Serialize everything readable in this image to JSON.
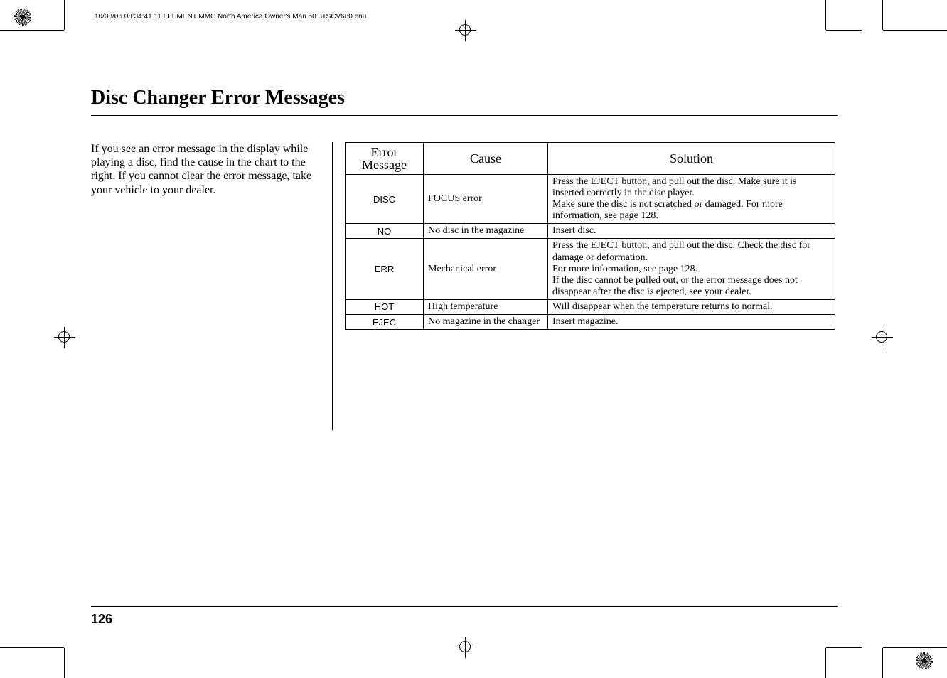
{
  "header": {
    "metadata": "10/08/06 08:34:41   11 ELEMENT MMC North America Owner's Man 50 31SCV680 enu"
  },
  "page_title": "Disc Changer Error Messages",
  "intro_text": "If you see an error message in the display while playing a disc, find the cause in the chart to the right. If you cannot clear the error message, take your vehicle to your dealer.",
  "table": {
    "headers": {
      "error": "Error Message",
      "cause": "Cause",
      "solution": "Solution"
    },
    "rows": [
      {
        "error": "DISC",
        "cause": "FOCUS error",
        "solution": "Press the EJECT button, and pull out the disc. Make sure it is inserted correctly in the disc player.\nMake sure the disc is not scratched or damaged. For more information, see page 128."
      },
      {
        "error": "NO",
        "cause": "No disc in the magazine",
        "solution": "Insert disc."
      },
      {
        "error": "ERR",
        "cause": "Mechanical error",
        "solution": "Press the EJECT button, and pull out the disc. Check the disc for damage or deformation.\nFor more information, see page 128.\nIf the disc cannot be pulled out, or the error message does not disappear after the disc is ejected, see your dealer."
      },
      {
        "error": "HOT",
        "cause": "High temperature",
        "solution": "Will disappear when the temperature returns to normal."
      },
      {
        "error": "EJEC",
        "cause": "No magazine in the changer",
        "solution": "Insert magazine."
      }
    ]
  },
  "page_number": "126",
  "chart_data": {
    "type": "table",
    "title": "Disc Changer Error Messages",
    "columns": [
      "Error Message",
      "Cause",
      "Solution"
    ],
    "rows": [
      [
        "DISC",
        "FOCUS error",
        "Press the EJECT button, and pull out the disc. Make sure it is inserted correctly in the disc player. Make sure the disc is not scratched or damaged. For more information, see page 128."
      ],
      [
        "NO",
        "No disc in the magazine",
        "Insert disc."
      ],
      [
        "ERR",
        "Mechanical error",
        "Press the EJECT button, and pull out the disc. Check the disc for damage or deformation. For more information, see page 128. If the disc cannot be pulled out, or the error message does not disappear after the disc is ejected, see your dealer."
      ],
      [
        "HOT",
        "High temperature",
        "Will disappear when the temperature returns to normal."
      ],
      [
        "EJEC",
        "No magazine in the changer",
        "Insert magazine."
      ]
    ]
  }
}
